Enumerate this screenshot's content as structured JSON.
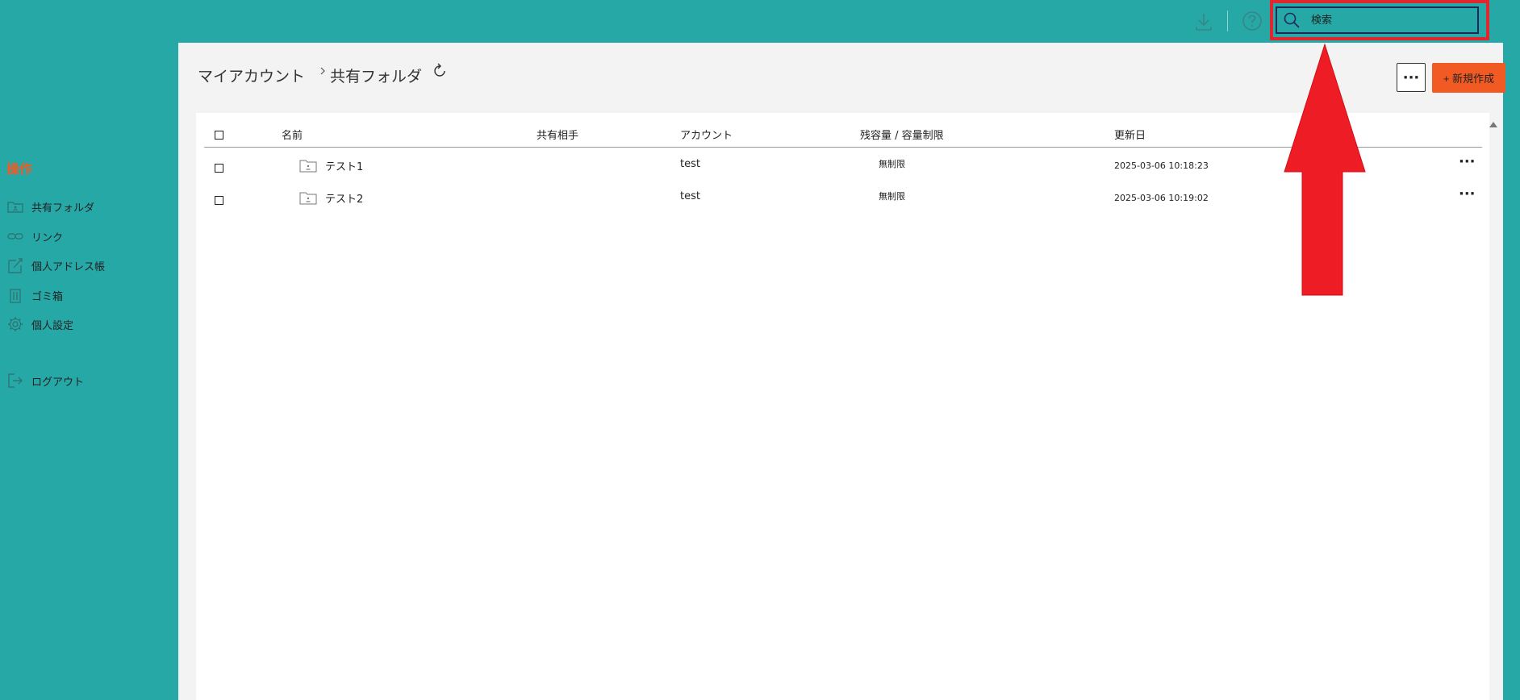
{
  "search": {
    "placeholder": "検索"
  },
  "sidebar": {
    "heading": "操作",
    "items": [
      {
        "label": "共有フォルダ",
        "icon": "shared-folder-icon"
      },
      {
        "label": "リンク",
        "icon": "link-icon"
      },
      {
        "label": "個人アドレス帳",
        "icon": "address-book-icon"
      },
      {
        "label": "ゴミ箱",
        "icon": "trash-icon"
      },
      {
        "label": "個人設定",
        "icon": "gear-icon"
      },
      {
        "label": "ログアウト",
        "icon": "logout-icon"
      }
    ]
  },
  "breadcrumb": {
    "root": "マイアカウント",
    "current": "共有フォルダ"
  },
  "toolbar": {
    "more_label": "···",
    "create_label": "+ 新規作成"
  },
  "table": {
    "headers": {
      "name": "名前",
      "shared_with": "共有相手",
      "account": "アカウント",
      "quota": "残容量 / 容量制限",
      "updated": "更新日"
    },
    "rows": [
      {
        "name": "テスト1",
        "shared_with": "",
        "account": "test",
        "quota": "無制限",
        "updated": "2025-03-06 10:18:23",
        "more": "···"
      },
      {
        "name": "テスト2",
        "shared_with": "",
        "account": "test",
        "quota": "無制限",
        "updated": "2025-03-06 10:19:02",
        "more": "···"
      }
    ]
  },
  "colors": {
    "teal": "#26a8a6",
    "accent": "#f15a22",
    "highlight": "#e3262e"
  }
}
